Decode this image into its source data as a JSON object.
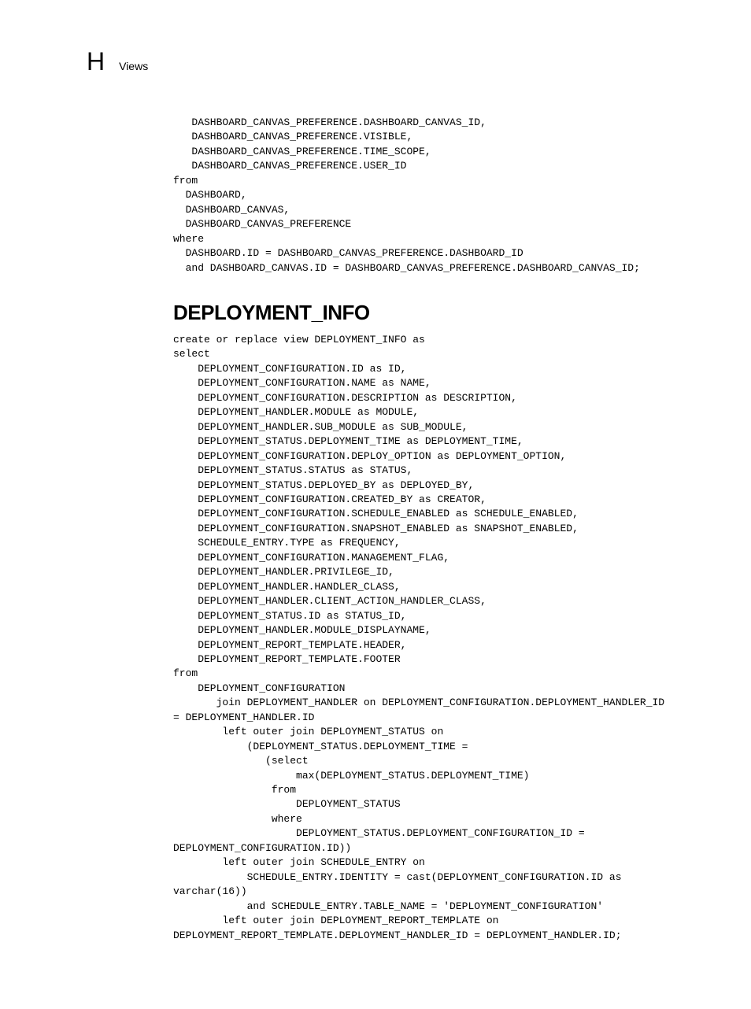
{
  "header": {
    "appendix_letter": "H",
    "title": "Views"
  },
  "block1": "   DASHBOARD_CANVAS_PREFERENCE.DASHBOARD_CANVAS_ID,\n   DASHBOARD_CANVAS_PREFERENCE.VISIBLE,\n   DASHBOARD_CANVAS_PREFERENCE.TIME_SCOPE,\n   DASHBOARD_CANVAS_PREFERENCE.USER_ID\nfrom\n  DASHBOARD,\n  DASHBOARD_CANVAS,\n  DASHBOARD_CANVAS_PREFERENCE\nwhere\n  DASHBOARD.ID = DASHBOARD_CANVAS_PREFERENCE.DASHBOARD_ID\n  and DASHBOARD_CANVAS.ID = DASHBOARD_CANVAS_PREFERENCE.DASHBOARD_CANVAS_ID;",
  "section_heading": "DEPLOYMENT_INFO",
  "block2": "create or replace view DEPLOYMENT_INFO as\nselect\n    DEPLOYMENT_CONFIGURATION.ID as ID,\n    DEPLOYMENT_CONFIGURATION.NAME as NAME,\n    DEPLOYMENT_CONFIGURATION.DESCRIPTION as DESCRIPTION,\n    DEPLOYMENT_HANDLER.MODULE as MODULE,\n    DEPLOYMENT_HANDLER.SUB_MODULE as SUB_MODULE,\n    DEPLOYMENT_STATUS.DEPLOYMENT_TIME as DEPLOYMENT_TIME,\n    DEPLOYMENT_CONFIGURATION.DEPLOY_OPTION as DEPLOYMENT_OPTION,\n    DEPLOYMENT_STATUS.STATUS as STATUS,\n    DEPLOYMENT_STATUS.DEPLOYED_BY as DEPLOYED_BY,\n    DEPLOYMENT_CONFIGURATION.CREATED_BY as CREATOR,\n    DEPLOYMENT_CONFIGURATION.SCHEDULE_ENABLED as SCHEDULE_ENABLED,\n    DEPLOYMENT_CONFIGURATION.SNAPSHOT_ENABLED as SNAPSHOT_ENABLED,\n    SCHEDULE_ENTRY.TYPE as FREQUENCY,\n    DEPLOYMENT_CONFIGURATION.MANAGEMENT_FLAG,\n    DEPLOYMENT_HANDLER.PRIVILEGE_ID,\n    DEPLOYMENT_HANDLER.HANDLER_CLASS,\n    DEPLOYMENT_HANDLER.CLIENT_ACTION_HANDLER_CLASS,\n    DEPLOYMENT_STATUS.ID as STATUS_ID,\n    DEPLOYMENT_HANDLER.MODULE_DISPLAYNAME,\n    DEPLOYMENT_REPORT_TEMPLATE.HEADER,\n    DEPLOYMENT_REPORT_TEMPLATE.FOOTER\nfrom\n    DEPLOYMENT_CONFIGURATION\n       join DEPLOYMENT_HANDLER on DEPLOYMENT_CONFIGURATION.DEPLOYMENT_HANDLER_ID \n= DEPLOYMENT_HANDLER.ID\n        left outer join DEPLOYMENT_STATUS on\n            (DEPLOYMENT_STATUS.DEPLOYMENT_TIME =\n               (select\n                    max(DEPLOYMENT_STATUS.DEPLOYMENT_TIME)\n                from\n                    DEPLOYMENT_STATUS\n                where\n                    DEPLOYMENT_STATUS.DEPLOYMENT_CONFIGURATION_ID = \nDEPLOYMENT_CONFIGURATION.ID))\n        left outer join SCHEDULE_ENTRY on\n            SCHEDULE_ENTRY.IDENTITY = cast(DEPLOYMENT_CONFIGURATION.ID as \nvarchar(16))\n            and SCHEDULE_ENTRY.TABLE_NAME = 'DEPLOYMENT_CONFIGURATION'\n        left outer join DEPLOYMENT_REPORT_TEMPLATE on \nDEPLOYMENT_REPORT_TEMPLATE.DEPLOYMENT_HANDLER_ID = DEPLOYMENT_HANDLER.ID;"
}
